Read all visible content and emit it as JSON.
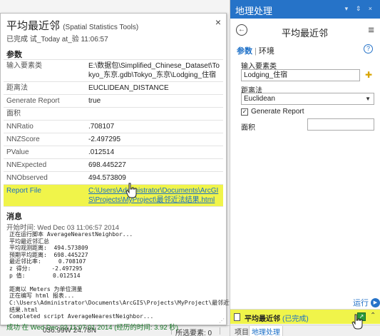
{
  "map": {
    "coordinates": "036.99W 24.78N",
    "selected_features": "所选要素: 0"
  },
  "popup": {
    "title": "平均最近邻",
    "subtitle": "(Spatial Statistics Tools)",
    "status": "已完成 试_Today at_验 11:06:57",
    "close_glyph": "×",
    "params_heading": "参数",
    "params": [
      {
        "key": "输入要素类",
        "value": "E:\\数据包\\Simplified_Chinese_Dataset\\Tokyo_东京.gdb\\Tokyo_东京\\Lodging_住宿"
      },
      {
        "key": "距离法",
        "value": "EUCLIDEAN_DISTANCE"
      },
      {
        "key": "Generate Report",
        "value": "true"
      },
      {
        "key": "面积",
        "value": ""
      },
      {
        "key": "NNRatio",
        "value": ".708107"
      },
      {
        "key": "NNZScore",
        "value": "-2.497295"
      },
      {
        "key": "PValue",
        "value": ".012514"
      },
      {
        "key": "NNExpected",
        "value": "698.445227"
      },
      {
        "key": "NNObserved",
        "value": "494.573809"
      },
      {
        "key": "Report File",
        "value": "C:\\Users\\Administrator\\Documents\\ArcGIS\\Projects\\MyProject\\最邻近法结果.html"
      }
    ],
    "messages_heading": "消息",
    "message_time": "开始时间: Wed Dec 03 11:06:57 2014",
    "message_log": "正在运行脚本 AverageNearestNeighbor...\n平均最近邻汇总\n平均观测距离:  494.573809\n预期平均距离:  698.445227\n最近邻比率:     0.708107\nz 得分:      -2.497295\np 值:        0.012514\n\n距离以 Meters 为单位测量\n正在编写 html 报表...\nC:\\Users\\Administrator\\Documents\\ArcGIS\\Projects\\MyProject\\最邻近法\n结果.html\nCompleted script AverageNearestNeighbor...",
    "message_done": "成功 在 Wed Dec 03 11:07:01 2014 (经历的时间: 3.92 秒)"
  },
  "gp": {
    "pane_title": "地理处理",
    "window_controls": "▾ ⇕ ×",
    "tool_name": "平均最近邻",
    "back_glyph": "←",
    "menu_glyph": "≡",
    "tab_params": "参数",
    "tab_env": "环境",
    "help_glyph": "?",
    "input_label": "输入要素类",
    "input_value": "Lodging_住宿",
    "distance_label": "距离法",
    "distance_value": "Euclidean",
    "report_label": "Generate Report",
    "report_checked": "✓",
    "area_label": "面积",
    "area_value": "",
    "run_label": "运行",
    "status_tool": "平均最近邻",
    "status_done": "(已完成)",
    "tab_project": "项目",
    "tab_geoprocessing": "地理处理"
  },
  "colors": {
    "accent": "#2673c8",
    "highlight": "#f0f44a",
    "link": "#1a6ec7"
  }
}
